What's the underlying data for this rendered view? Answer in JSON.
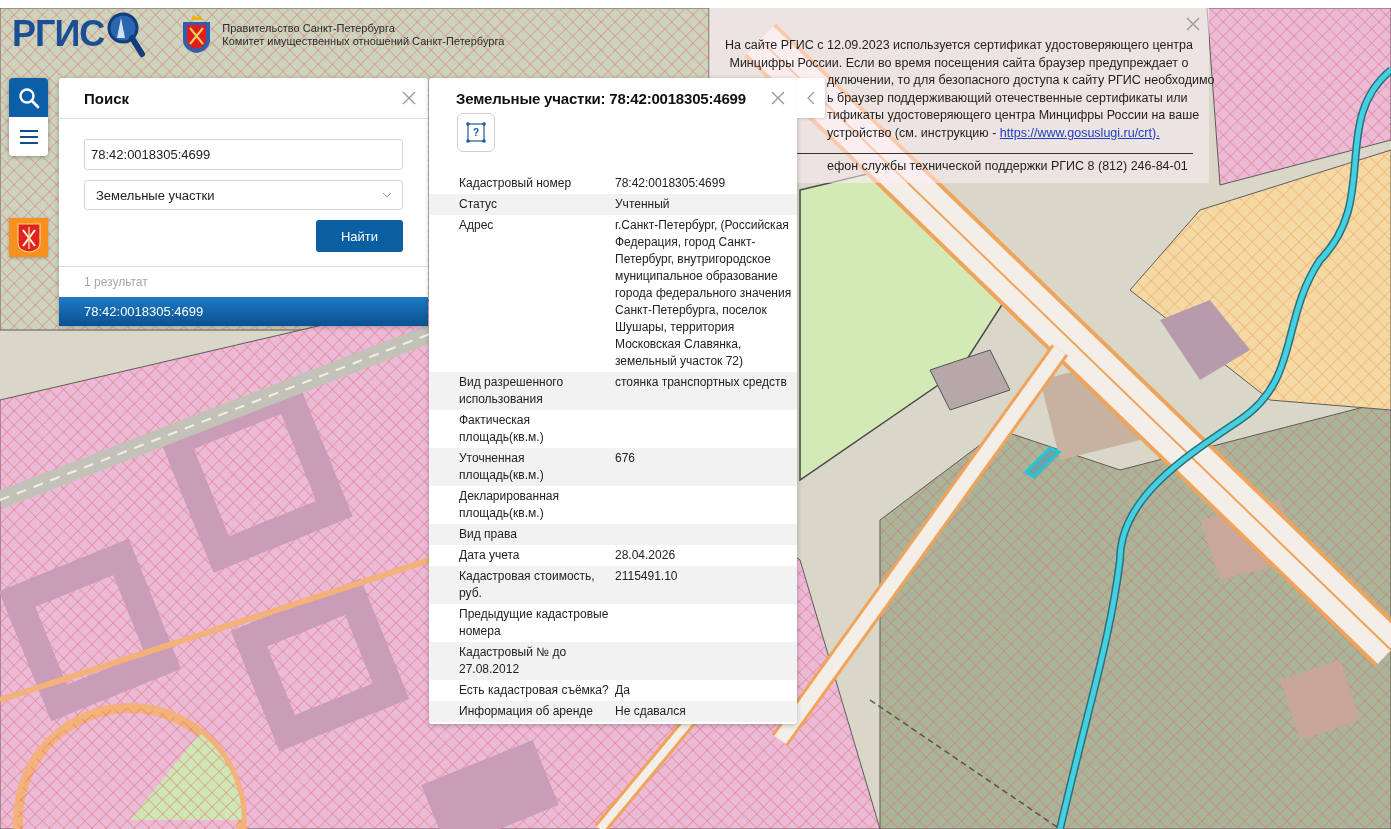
{
  "header": {
    "logo": "РГИС",
    "org_lines": [
      "Правительство Санкт-Петербурга",
      "Комитет имущественных отношений Санкт-Петербурга"
    ]
  },
  "toolbar": [
    {
      "kind": "search",
      "selected": true
    },
    {
      "kind": "menu",
      "selected": false
    }
  ],
  "search_panel": {
    "title": "Поиск",
    "query": "78:42:0018305:4699",
    "layer": "Земельные участки",
    "button": "Найти",
    "result_count": "1 результат",
    "results": [
      {
        "label": "78:42:0018305:4699",
        "selected": true
      }
    ]
  },
  "info_panel": {
    "title": "Земельные участки: 78:42:0018305:4699",
    "shape_button": "?",
    "rows": [
      {
        "label": "Кадастровый номер",
        "value": "78:42:0018305:4699"
      },
      {
        "label": "Статус",
        "value": "Учтенный"
      },
      {
        "label": "Адрес",
        "value": "г.Санкт-Петербург, (Российская Федерация, город Санкт-Петербург, внутригородское муниципальное образование города федерального значения Санкт-Петербурга, поселок Шушары, территория Московская Славянка, земельный участок 72)"
      },
      {
        "label": "Вид разрешенного использования",
        "value": "стоянка транспортных средств"
      },
      {
        "label": "Фактическая площадь(кв.м.)"
      },
      {
        "label": "Уточненная площадь(кв.м.)",
        "value": "676"
      },
      {
        "label": "Декларированная площадь(кв.м.)"
      },
      {
        "label": "Вид права"
      },
      {
        "label": "Дата учета",
        "value": "28.04.2026"
      },
      {
        "label": "Кадастровая стоимость, руб.",
        "value": "2115491.10"
      },
      {
        "label": "Предыдущие кадастровые номера"
      },
      {
        "label": "Кадастровый № до 27.08.2012"
      },
      {
        "label": "Есть кадастровая съёмка?",
        "value": "Да"
      },
      {
        "label": "Информация об аренде",
        "value": "Не сдавался"
      }
    ]
  },
  "notice": {
    "lines": [
      {
        "kind": "full",
        "text": "На сайте РГИС с 12.09.2023 используется сертификат удостоверяющего центра"
      },
      {
        "kind": "full",
        "text": "Минцифры России. Если во время посещения сайта браузер предупреждает о"
      },
      {
        "kind": "cut",
        "text": "дключении, то для безопасного доступа к сайту РГИС необходимо"
      },
      {
        "kind": "cut",
        "text": "ь браузер поддерживающий отечественные сертификаты или"
      },
      {
        "kind": "cut",
        "text": "тификаты удостоверяющего центра Минцифры России на ваше"
      },
      {
        "kind": "cut",
        "text": "устройство (см. инструкцию -",
        "link": "https://www.gosuslugi.ru/crt)."
      }
    ],
    "support": "ефон службы технической поддержки РГИС 8 (812) 246-84-01"
  }
}
